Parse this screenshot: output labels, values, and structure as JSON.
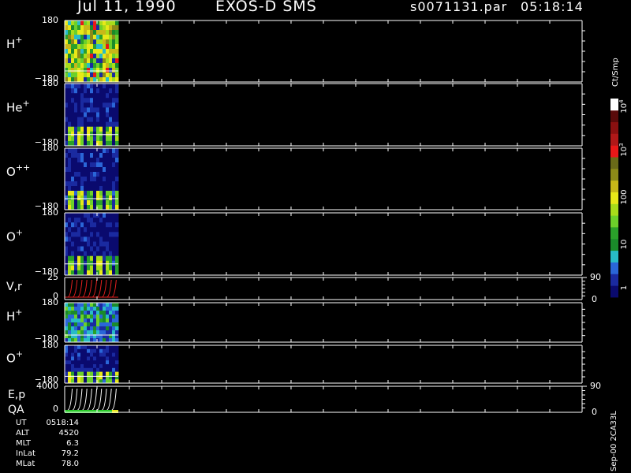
{
  "header": {
    "date": "Jul 11, 1990",
    "mission": "EXOS-D SMS",
    "file": "s0071131.par",
    "time": "05:18:14"
  },
  "colorbar": {
    "unit_label": "Ct/Smp",
    "ticks": [
      "1",
      "10",
      "100",
      "10",
      "10"
    ],
    "tick_exponents": [
      "",
      "",
      "",
      "3",
      "4"
    ],
    "colors_bottom_to_top": [
      "#0a0a6e",
      "#1a2aa0",
      "#2a66d8",
      "#28bcc6",
      "#1a8a2a",
      "#2aa02a",
      "#6cd02a",
      "#a8dc1a",
      "#e8e818",
      "#c8b818",
      "#8c8a18",
      "#6a6a18",
      "#e81818",
      "#b01818",
      "#8a1010",
      "#5a0a0a",
      "#ffffff"
    ]
  },
  "credit": "Sep-00 2CA33L",
  "readout": [
    {
      "label": "UT",
      "value": "0518:14"
    },
    {
      "label": "ALT",
      "value": "4520"
    },
    {
      "label": "MLT",
      "value": "6.3"
    },
    {
      "label": "InLat",
      "value": "79.2"
    },
    {
      "label": "MLat",
      "value": "78.0"
    }
  ],
  "chart_data": [
    {
      "type": "heatmap",
      "species": "H",
      "charge": "+",
      "ylim": [
        -180,
        180
      ],
      "ticks": [
        "180",
        "−180"
      ],
      "palette": "full"
    },
    {
      "type": "heatmap",
      "species": "He",
      "charge": "+",
      "ylim": [
        -180,
        180
      ],
      "ticks": [
        "180",
        "−180"
      ],
      "palette": "low"
    },
    {
      "type": "heatmap",
      "species": "O",
      "charge": "++",
      "ylim": [
        -180,
        180
      ],
      "ticks": [
        "180",
        "−180"
      ],
      "palette": "low"
    },
    {
      "type": "heatmap",
      "species": "O",
      "charge": "+",
      "ylim": [
        -180,
        180
      ],
      "ticks": [
        "180",
        "−180"
      ],
      "palette": "low"
    },
    {
      "type": "line",
      "label": "V,r",
      "ylim": [
        0,
        25
      ],
      "ticks": [
        "25",
        "0"
      ],
      "right_ticks": [
        "90",
        "0"
      ],
      "color": "#e82020"
    },
    {
      "type": "heatmap",
      "species": "H",
      "charge": "+",
      "ylim": [
        -180,
        180
      ],
      "ticks": [
        "180",
        "−180"
      ],
      "palette": "mid"
    },
    {
      "type": "heatmap",
      "species": "O",
      "charge": "+",
      "ylim": [
        -180,
        180
      ],
      "ticks": [
        "180",
        "−180"
      ],
      "palette": "low"
    },
    {
      "type": "line",
      "label": "E,p",
      "label2": "QA",
      "ylim": [
        0,
        4000
      ],
      "ticks": [
        "4000",
        "0"
      ],
      "right_ticks": [
        "90",
        "0"
      ],
      "color": "#ffffff",
      "qa_colors": [
        "#28c828",
        "#e8e818"
      ]
    }
  ]
}
